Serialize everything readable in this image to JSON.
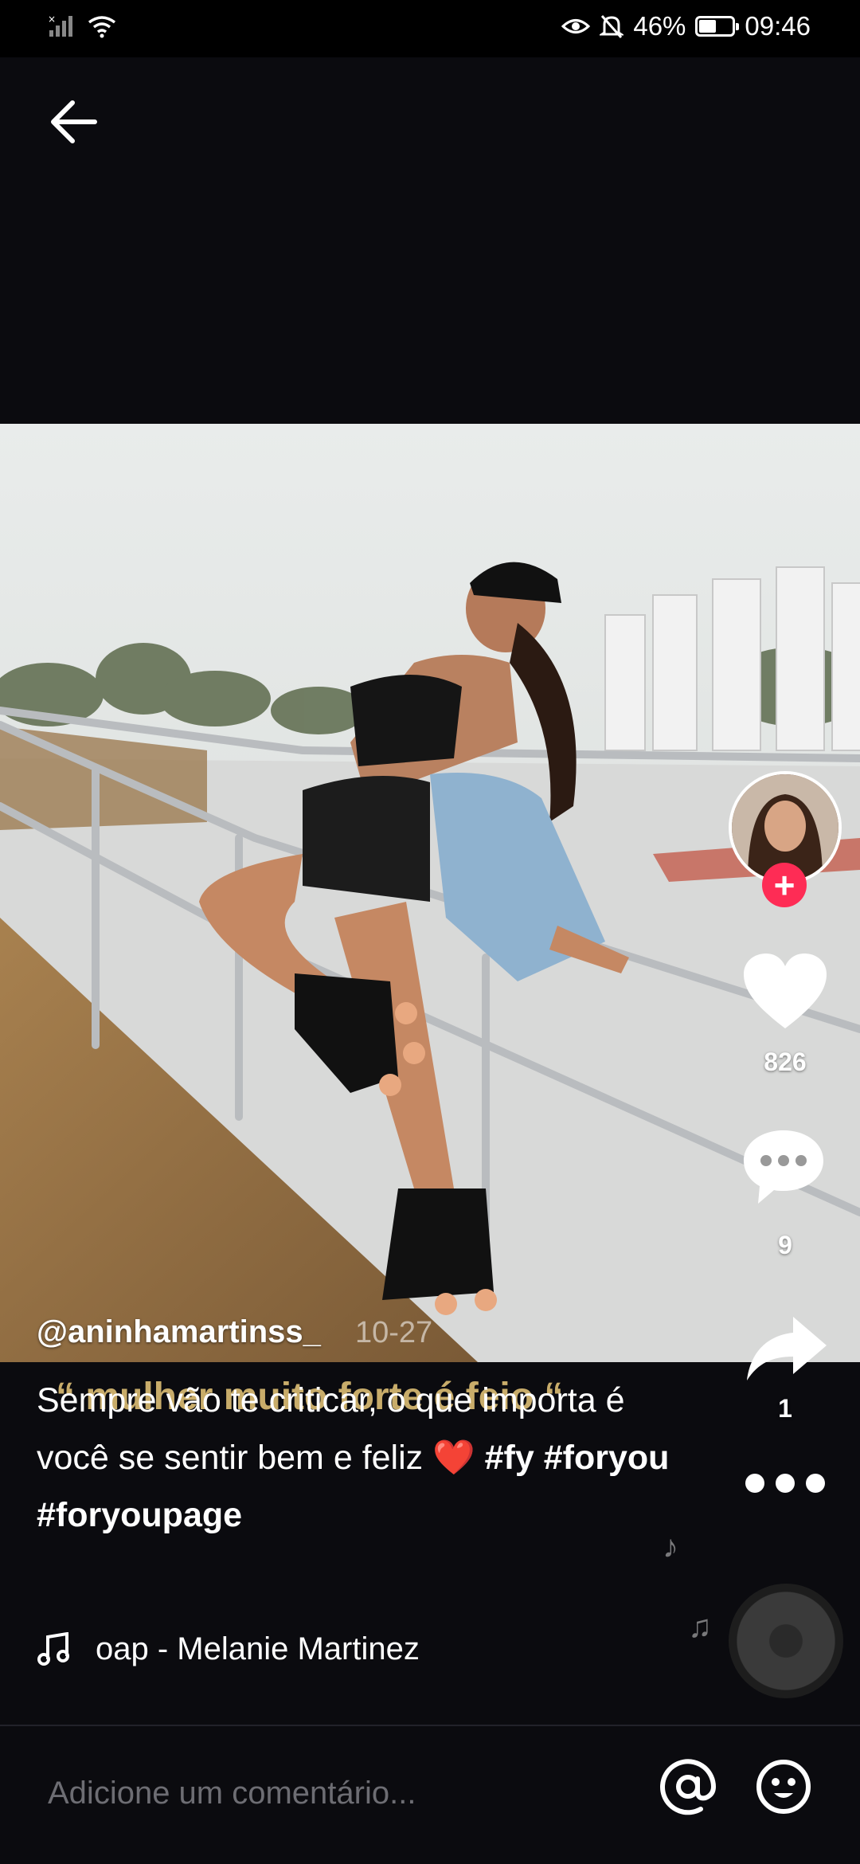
{
  "status_bar": {
    "battery": "46%",
    "time": "09:46",
    "battery_level": 0.46
  },
  "post": {
    "username": "@aninhamartinss_",
    "date": "10-27",
    "overlay_text": "“ mulher muito forte é feio “",
    "caption_text": "Sempre vão te criticar, o que importa é você se sentir bem e feliz",
    "caption_emoji": "❤️",
    "hashtags": "#fy #foryou #foryoupage",
    "music": "oap - Melanie Martinez"
  },
  "actions": {
    "likes": "826",
    "comments": "9",
    "shares": "1"
  },
  "comment_bar": {
    "placeholder": "Adicione um comentário..."
  },
  "colors": {
    "accent": "#fe2c55",
    "background": "#0b0b0f"
  },
  "icons": [
    "back-arrow-icon",
    "heart-icon",
    "comment-icon",
    "share-icon",
    "more-icon",
    "music-note-icon",
    "at-icon",
    "emoji-icon",
    "eye-icon",
    "mute-bell-icon",
    "wifi-icon",
    "signal-icon"
  ]
}
